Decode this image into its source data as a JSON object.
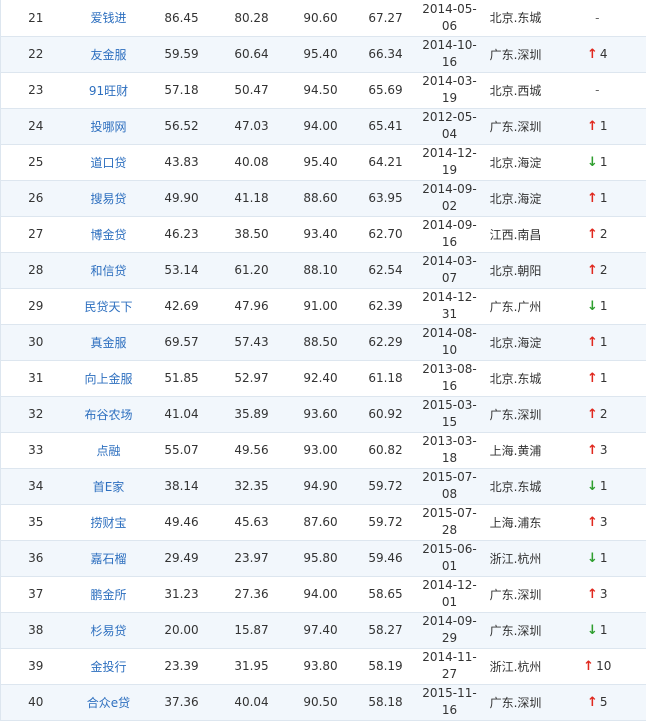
{
  "colors": {
    "link": "#2d6fbf",
    "up_arrow": "#e0281e",
    "down_arrow": "#2e9e2e",
    "stripe": "#f2f7fc",
    "border": "#dde6ef"
  },
  "icons": {
    "up": "up-arrow-icon",
    "down": "down-arrow-icon"
  },
  "rows": [
    {
      "rank": "21",
      "platform": "爱钱进",
      "s1": "86.45",
      "s2": "80.28",
      "s3": "90.60",
      "total": "67.27",
      "date": "2014-05-06",
      "region": "北京.东城",
      "dir": "none",
      "change": "-"
    },
    {
      "rank": "22",
      "platform": "友金服",
      "s1": "59.59",
      "s2": "60.64",
      "s3": "95.40",
      "total": "66.34",
      "date": "2014-10-16",
      "region": "广东.深圳",
      "dir": "up",
      "change": "4"
    },
    {
      "rank": "23",
      "platform": "91旺财",
      "s1": "57.18",
      "s2": "50.47",
      "s3": "94.50",
      "total": "65.69",
      "date": "2014-03-19",
      "region": "北京.西城",
      "dir": "none",
      "change": "-"
    },
    {
      "rank": "24",
      "platform": "投哪网",
      "s1": "56.52",
      "s2": "47.03",
      "s3": "94.00",
      "total": "65.41",
      "date": "2012-05-04",
      "region": "广东.深圳",
      "dir": "up",
      "change": "1"
    },
    {
      "rank": "25",
      "platform": "道口贷",
      "s1": "43.83",
      "s2": "40.08",
      "s3": "95.40",
      "total": "64.21",
      "date": "2014-12-19",
      "region": "北京.海淀",
      "dir": "down",
      "change": "1"
    },
    {
      "rank": "26",
      "platform": "搜易贷",
      "s1": "49.90",
      "s2": "41.18",
      "s3": "88.60",
      "total": "63.95",
      "date": "2014-09-02",
      "region": "北京.海淀",
      "dir": "up",
      "change": "1"
    },
    {
      "rank": "27",
      "platform": "博金贷",
      "s1": "46.23",
      "s2": "38.50",
      "s3": "93.40",
      "total": "62.70",
      "date": "2014-09-16",
      "region": "江西.南昌",
      "dir": "up",
      "change": "2"
    },
    {
      "rank": "28",
      "platform": "和信贷",
      "s1": "53.14",
      "s2": "61.20",
      "s3": "88.10",
      "total": "62.54",
      "date": "2014-03-07",
      "region": "北京.朝阳",
      "dir": "up",
      "change": "2"
    },
    {
      "rank": "29",
      "platform": "民贷天下",
      "s1": "42.69",
      "s2": "47.96",
      "s3": "91.00",
      "total": "62.39",
      "date": "2014-12-31",
      "region": "广东.广州",
      "dir": "down",
      "change": "1"
    },
    {
      "rank": "30",
      "platform": "真金服",
      "s1": "69.57",
      "s2": "57.43",
      "s3": "88.50",
      "total": "62.29",
      "date": "2014-08-10",
      "region": "北京.海淀",
      "dir": "up",
      "change": "1"
    },
    {
      "rank": "31",
      "platform": "向上金服",
      "s1": "51.85",
      "s2": "52.97",
      "s3": "92.40",
      "total": "61.18",
      "date": "2013-08-16",
      "region": "北京.东城",
      "dir": "up",
      "change": "1"
    },
    {
      "rank": "32",
      "platform": "布谷农场",
      "s1": "41.04",
      "s2": "35.89",
      "s3": "93.60",
      "total": "60.92",
      "date": "2015-03-15",
      "region": "广东.深圳",
      "dir": "up",
      "change": "2"
    },
    {
      "rank": "33",
      "platform": "点融",
      "s1": "55.07",
      "s2": "49.56",
      "s3": "93.00",
      "total": "60.82",
      "date": "2013-03-18",
      "region": "上海.黄浦",
      "dir": "up",
      "change": "3"
    },
    {
      "rank": "34",
      "platform": "首E家",
      "s1": "38.14",
      "s2": "32.35",
      "s3": "94.90",
      "total": "59.72",
      "date": "2015-07-08",
      "region": "北京.东城",
      "dir": "down",
      "change": "1"
    },
    {
      "rank": "35",
      "platform": "捞财宝",
      "s1": "49.46",
      "s2": "45.63",
      "s3": "87.60",
      "total": "59.72",
      "date": "2015-07-28",
      "region": "上海.浦东",
      "dir": "up",
      "change": "3"
    },
    {
      "rank": "36",
      "platform": "嘉石榴",
      "s1": "29.49",
      "s2": "23.97",
      "s3": "95.80",
      "total": "59.46",
      "date": "2015-06-01",
      "region": "浙江.杭州",
      "dir": "down",
      "change": "1"
    },
    {
      "rank": "37",
      "platform": "鹏金所",
      "s1": "31.23",
      "s2": "27.36",
      "s3": "94.00",
      "total": "58.65",
      "date": "2014-12-01",
      "region": "广东.深圳",
      "dir": "up",
      "change": "3"
    },
    {
      "rank": "38",
      "platform": "杉易贷",
      "s1": "20.00",
      "s2": "15.87",
      "s3": "97.40",
      "total": "58.27",
      "date": "2014-09-29",
      "region": "广东.深圳",
      "dir": "down",
      "change": "1"
    },
    {
      "rank": "39",
      "platform": "金投行",
      "s1": "23.39",
      "s2": "31.95",
      "s3": "93.80",
      "total": "58.19",
      "date": "2014-11-27",
      "region": "浙江.杭州",
      "dir": "up",
      "change": "10"
    },
    {
      "rank": "40",
      "platform": "合众e贷",
      "s1": "37.36",
      "s2": "40.04",
      "s3": "90.50",
      "total": "58.18",
      "date": "2015-11-16",
      "region": "广东.深圳",
      "dir": "up",
      "change": "5"
    }
  ]
}
